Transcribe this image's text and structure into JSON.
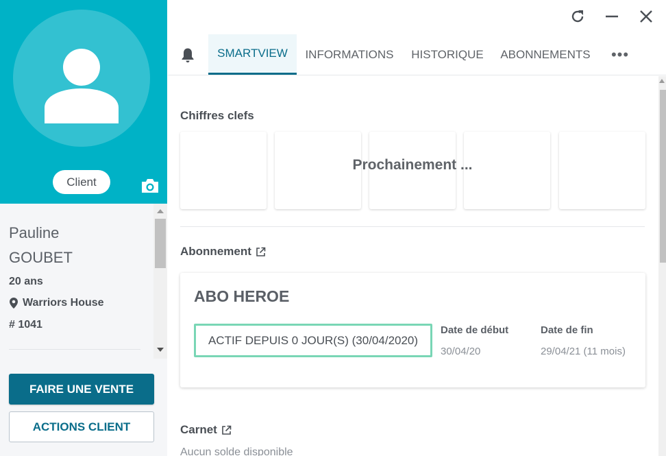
{
  "colors": {
    "accent": "#00b2c6",
    "primary": "#0a6d8a",
    "status_border": "#79d6b5"
  },
  "profile": {
    "badge": "Client",
    "first_name": "Pauline",
    "last_name": "GOUBET",
    "age": "20 ans",
    "location": "Warriors House",
    "id": "# 1041",
    "icons": [
      "user-silhouette-icon",
      "camera-icon",
      "location-pin-icon"
    ]
  },
  "actions": {
    "sale": "FAIRE UNE VENTE",
    "client_actions": "ACTIONS CLIENT"
  },
  "window": {
    "icons": [
      "refresh-icon",
      "minimize-icon",
      "close-icon"
    ]
  },
  "tabs": {
    "bell_icon": "bell-icon",
    "items": [
      {
        "label": "SMARTVIEW",
        "active": true
      },
      {
        "label": "INFORMATIONS",
        "active": false
      },
      {
        "label": "HISTORIQUE",
        "active": false
      },
      {
        "label": "ABONNEMENTS",
        "active": false
      }
    ],
    "more": "•••"
  },
  "smartview": {
    "key_figures_title": "Chiffres clefs",
    "coming_soon": "Prochainement ...",
    "subscription_title": "Abonnement",
    "subscription": {
      "name": "ABO HEROE",
      "status": "ACTIF DEPUIS 0 JOUR(S) (30/04/2020)",
      "start_label": "Date de début",
      "start_value": "30/04/20",
      "end_label": "Date de fin",
      "end_value": "29/04/21 (11 mois)"
    },
    "carnet_title": "Carnet",
    "carnet_empty": "Aucun solde disponible"
  }
}
